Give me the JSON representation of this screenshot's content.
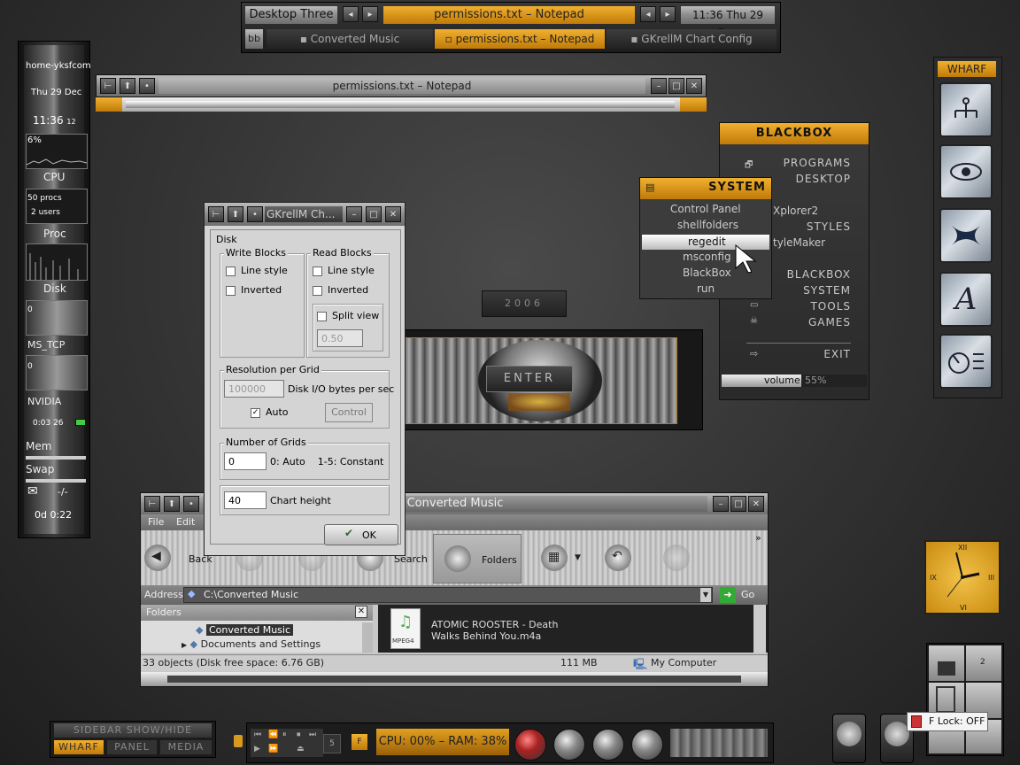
{
  "top_bar": {
    "workspace": "Desktop Three",
    "active_window": "permissions.txt – Notepad",
    "clock": "11:36 Thu 29 Dec",
    "task_toggle": "bb",
    "tasks": [
      {
        "label": "Converted Music",
        "active": false
      },
      {
        "label": "permissions.txt – Notepad",
        "active": true
      },
      {
        "label": "GKrellM Chart Config",
        "active": false
      }
    ]
  },
  "gkrellm": {
    "hostname": "home-yksfcom",
    "date": "Thu 29 Dec",
    "time": "11:36",
    "seconds": "12",
    "cpu_percent": "6%",
    "cpu_label": "CPU",
    "procs": "50 procs",
    "users": "2 users",
    "proc_label": "Proc",
    "disk_label": "Disk",
    "disk_value": "0",
    "net_label": "MS_TCP",
    "net_value": "0",
    "gpu_label": "NVIDIA",
    "uptime_time": "0:03 26",
    "mem_label": "Mem",
    "swap_label": "Swap",
    "mail_icon": "envelope-icon",
    "mail_count": "-/-",
    "uptime": "0d  0:22"
  },
  "notepad": {
    "title": "permissions.txt – Notepad"
  },
  "chart_config": {
    "title": "GKrellM Ch...",
    "section": "Disk",
    "write_blocks": "Write Blocks",
    "read_blocks": "Read Blocks",
    "line_style": "Line style",
    "inverted": "Inverted",
    "split_view": "Split view",
    "split_value": "0.50",
    "resolution_label": "Resolution per Grid",
    "resolution_value": "100000",
    "resolution_unit": "Disk I/O bytes per sec",
    "auto_label": "Auto",
    "control_button": "Control",
    "grids_label": "Number of Grids",
    "grids_value": "0",
    "grids_help": "0: Auto    1-5: Constant",
    "height_value": "40",
    "height_label": "Chart height",
    "ok_button": "OK"
  },
  "year_label": "2006",
  "enter_label": "ENTER",
  "blackbox": {
    "title": "BLACKBOX",
    "items": [
      {
        "label": "PROGRAMS",
        "icon": "folder-icon"
      },
      {
        "label": "DESKTOP",
        "icon": ""
      },
      {
        "label": "Xplorer2",
        "icon": ""
      },
      {
        "label": "STYLES",
        "icon": ""
      },
      {
        "label": "tyleMaker",
        "icon": ""
      },
      {
        "label": "BLACKBOX",
        "icon": ""
      },
      {
        "label": "SYSTEM",
        "icon": ""
      },
      {
        "label": "TOOLS",
        "icon": "window-icon"
      },
      {
        "label": "GAMES",
        "icon": "skull-icon"
      },
      {
        "label": "EXIT",
        "icon": "exit-icon"
      }
    ],
    "volume_label": "volume",
    "volume_value": "55%",
    "volume_level": 0.55
  },
  "system_menu": {
    "title": "SYSTEM",
    "items": [
      "Control Panel",
      "shellfolders",
      "regedit",
      "msconfig",
      "BlackBox",
      "run"
    ],
    "selected": "regedit"
  },
  "wharf": {
    "title": "WHARF",
    "icons": [
      "network-icon",
      "eye-icon",
      "x-logo-icon",
      "font-icon",
      "knob-settings-icon"
    ]
  },
  "explorer": {
    "title": "Converted Music",
    "menu": [
      "File",
      "Edit"
    ],
    "toolbar": {
      "back": "Back",
      "search": "Search",
      "folders": "Folders"
    },
    "address_label": "Address",
    "address_value": "C:\\Converted Music",
    "go_label": "Go",
    "folders_pane_title": "Folders",
    "tree": [
      "Converted Music",
      "Documents and Settings"
    ],
    "file_name": "ATOMIC ROOSTER - Death Walks Behind You.m4a",
    "file_badge": "MPEG4",
    "status_objects": "33 objects (Disk free space: 6.76 GB)",
    "status_size": "111 MB",
    "status_location": "My Computer"
  },
  "clock_widget": {
    "numerals": [
      "XII",
      "III",
      "VI",
      "IX"
    ]
  },
  "pager": {
    "cells": [
      "",
      "2",
      "",
      "",
      "",
      ""
    ]
  },
  "sidebar": {
    "toggle": "SIDEBAR SHOW/HIDE",
    "tabs": [
      "WHARF",
      "PANEL",
      "MEDIA"
    ],
    "active_tab": "WHARF"
  },
  "taskbar": {
    "workspace_number": "5",
    "cpu_ram": "CPU: 00% – RAM: 38%"
  },
  "tooltip": {
    "text": "F Lock: OFF"
  }
}
